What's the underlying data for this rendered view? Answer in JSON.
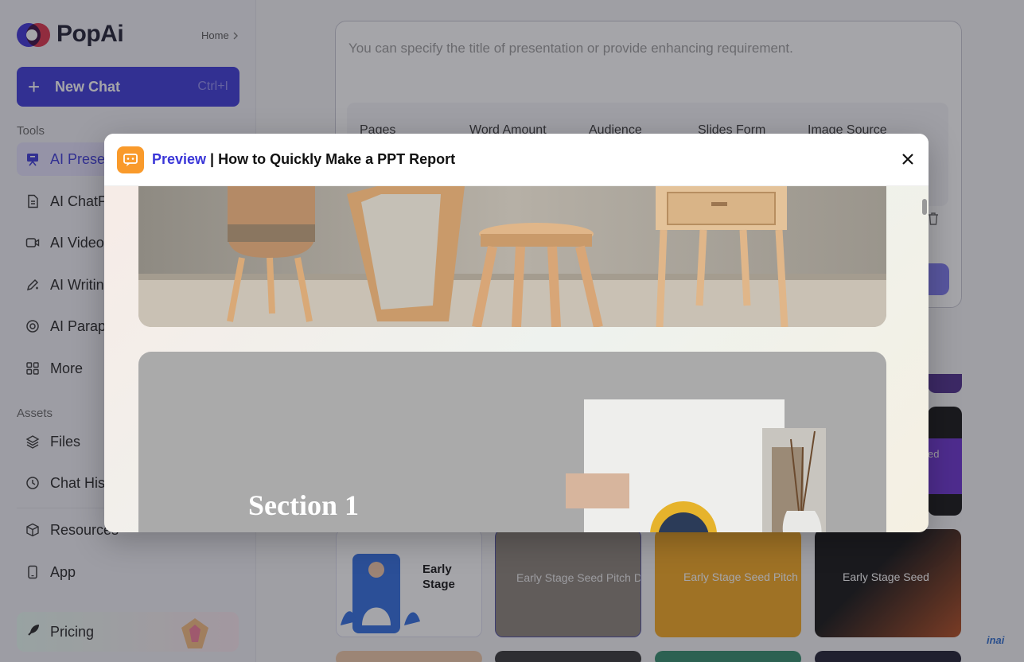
{
  "brand": {
    "name": "PopAi"
  },
  "header": {
    "home_label": "Home"
  },
  "sidebar": {
    "new_chat_label": "New Chat",
    "new_chat_shortcut": "Ctrl+I",
    "tools_heading": "Tools",
    "tools": [
      {
        "label": "AI Prese",
        "icon": "presentation-icon"
      },
      {
        "label": "AI ChatP",
        "icon": "document-icon"
      },
      {
        "label": "AI Video",
        "icon": "video-icon"
      },
      {
        "label": "AI Writin",
        "icon": "pen-icon"
      },
      {
        "label": "AI Parap",
        "icon": "paraphrase-icon"
      },
      {
        "label": "More",
        "icon": "grid-icon"
      }
    ],
    "assets_heading": "Assets",
    "assets": [
      {
        "label": "Files",
        "icon": "layers-icon"
      },
      {
        "label": "Chat His",
        "icon": "history-icon"
      }
    ],
    "extra": [
      {
        "label": "Resources",
        "icon": "cube-icon"
      },
      {
        "label": "App",
        "icon": "phone-icon"
      }
    ],
    "pricing_label": "Pricing"
  },
  "main": {
    "prompt_placeholder": "You can specify the title of presentation or provide enhancing requirement.",
    "option_labels": [
      "Pages",
      "Word Amount",
      "Audience",
      "Slides Form",
      "Image Source"
    ],
    "templates": [
      {
        "title": "Early Stage Seed Pitch"
      },
      {
        "title": "Early Stage Seed Pitch De"
      },
      {
        "title": "Early Stage Seed Pitch D"
      },
      {
        "title": "Early Stage Seed"
      }
    ],
    "purple_card_text": "ed"
  },
  "modal": {
    "title_accent": "Preview",
    "title_rest": " | How to Quickly Make a PPT Report",
    "section_text": "Section 1"
  },
  "watermark": "inai",
  "colors": {
    "accent": "#3a36d8",
    "modal_icon": "#f99a2b"
  }
}
